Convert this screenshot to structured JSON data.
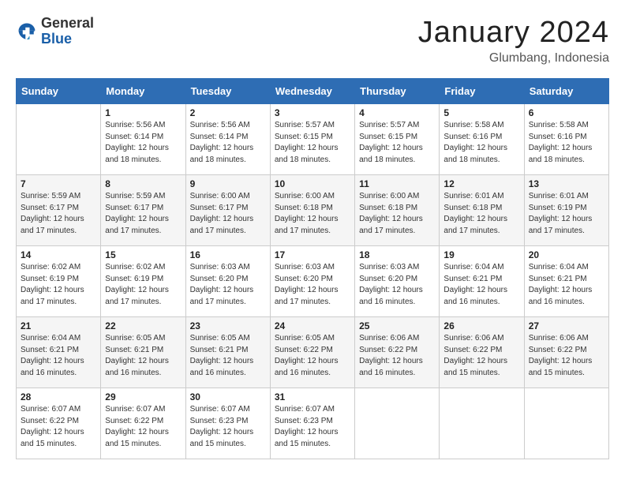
{
  "header": {
    "logo_general": "General",
    "logo_blue": "Blue",
    "month_title": "January 2024",
    "location": "Glumbang, Indonesia"
  },
  "weekdays": [
    "Sunday",
    "Monday",
    "Tuesday",
    "Wednesday",
    "Thursday",
    "Friday",
    "Saturday"
  ],
  "weeks": [
    [
      {
        "day": "",
        "sunrise": "",
        "sunset": "",
        "daylight": ""
      },
      {
        "day": "1",
        "sunrise": "Sunrise: 5:56 AM",
        "sunset": "Sunset: 6:14 PM",
        "daylight": "Daylight: 12 hours and 18 minutes."
      },
      {
        "day": "2",
        "sunrise": "Sunrise: 5:56 AM",
        "sunset": "Sunset: 6:14 PM",
        "daylight": "Daylight: 12 hours and 18 minutes."
      },
      {
        "day": "3",
        "sunrise": "Sunrise: 5:57 AM",
        "sunset": "Sunset: 6:15 PM",
        "daylight": "Daylight: 12 hours and 18 minutes."
      },
      {
        "day": "4",
        "sunrise": "Sunrise: 5:57 AM",
        "sunset": "Sunset: 6:15 PM",
        "daylight": "Daylight: 12 hours and 18 minutes."
      },
      {
        "day": "5",
        "sunrise": "Sunrise: 5:58 AM",
        "sunset": "Sunset: 6:16 PM",
        "daylight": "Daylight: 12 hours and 18 minutes."
      },
      {
        "day": "6",
        "sunrise": "Sunrise: 5:58 AM",
        "sunset": "Sunset: 6:16 PM",
        "daylight": "Daylight: 12 hours and 18 minutes."
      }
    ],
    [
      {
        "day": "7",
        "sunrise": "Sunrise: 5:59 AM",
        "sunset": "Sunset: 6:17 PM",
        "daylight": "Daylight: 12 hours and 17 minutes."
      },
      {
        "day": "8",
        "sunrise": "Sunrise: 5:59 AM",
        "sunset": "Sunset: 6:17 PM",
        "daylight": "Daylight: 12 hours and 17 minutes."
      },
      {
        "day": "9",
        "sunrise": "Sunrise: 6:00 AM",
        "sunset": "Sunset: 6:17 PM",
        "daylight": "Daylight: 12 hours and 17 minutes."
      },
      {
        "day": "10",
        "sunrise": "Sunrise: 6:00 AM",
        "sunset": "Sunset: 6:18 PM",
        "daylight": "Daylight: 12 hours and 17 minutes."
      },
      {
        "day": "11",
        "sunrise": "Sunrise: 6:00 AM",
        "sunset": "Sunset: 6:18 PM",
        "daylight": "Daylight: 12 hours and 17 minutes."
      },
      {
        "day": "12",
        "sunrise": "Sunrise: 6:01 AM",
        "sunset": "Sunset: 6:18 PM",
        "daylight": "Daylight: 12 hours and 17 minutes."
      },
      {
        "day": "13",
        "sunrise": "Sunrise: 6:01 AM",
        "sunset": "Sunset: 6:19 PM",
        "daylight": "Daylight: 12 hours and 17 minutes."
      }
    ],
    [
      {
        "day": "14",
        "sunrise": "Sunrise: 6:02 AM",
        "sunset": "Sunset: 6:19 PM",
        "daylight": "Daylight: 12 hours and 17 minutes."
      },
      {
        "day": "15",
        "sunrise": "Sunrise: 6:02 AM",
        "sunset": "Sunset: 6:19 PM",
        "daylight": "Daylight: 12 hours and 17 minutes."
      },
      {
        "day": "16",
        "sunrise": "Sunrise: 6:03 AM",
        "sunset": "Sunset: 6:20 PM",
        "daylight": "Daylight: 12 hours and 17 minutes."
      },
      {
        "day": "17",
        "sunrise": "Sunrise: 6:03 AM",
        "sunset": "Sunset: 6:20 PM",
        "daylight": "Daylight: 12 hours and 17 minutes."
      },
      {
        "day": "18",
        "sunrise": "Sunrise: 6:03 AM",
        "sunset": "Sunset: 6:20 PM",
        "daylight": "Daylight: 12 hours and 16 minutes."
      },
      {
        "day": "19",
        "sunrise": "Sunrise: 6:04 AM",
        "sunset": "Sunset: 6:21 PM",
        "daylight": "Daylight: 12 hours and 16 minutes."
      },
      {
        "day": "20",
        "sunrise": "Sunrise: 6:04 AM",
        "sunset": "Sunset: 6:21 PM",
        "daylight": "Daylight: 12 hours and 16 minutes."
      }
    ],
    [
      {
        "day": "21",
        "sunrise": "Sunrise: 6:04 AM",
        "sunset": "Sunset: 6:21 PM",
        "daylight": "Daylight: 12 hours and 16 minutes."
      },
      {
        "day": "22",
        "sunrise": "Sunrise: 6:05 AM",
        "sunset": "Sunset: 6:21 PM",
        "daylight": "Daylight: 12 hours and 16 minutes."
      },
      {
        "day": "23",
        "sunrise": "Sunrise: 6:05 AM",
        "sunset": "Sunset: 6:21 PM",
        "daylight": "Daylight: 12 hours and 16 minutes."
      },
      {
        "day": "24",
        "sunrise": "Sunrise: 6:05 AM",
        "sunset": "Sunset: 6:22 PM",
        "daylight": "Daylight: 12 hours and 16 minutes."
      },
      {
        "day": "25",
        "sunrise": "Sunrise: 6:06 AM",
        "sunset": "Sunset: 6:22 PM",
        "daylight": "Daylight: 12 hours and 16 minutes."
      },
      {
        "day": "26",
        "sunrise": "Sunrise: 6:06 AM",
        "sunset": "Sunset: 6:22 PM",
        "daylight": "Daylight: 12 hours and 15 minutes."
      },
      {
        "day": "27",
        "sunrise": "Sunrise: 6:06 AM",
        "sunset": "Sunset: 6:22 PM",
        "daylight": "Daylight: 12 hours and 15 minutes."
      }
    ],
    [
      {
        "day": "28",
        "sunrise": "Sunrise: 6:07 AM",
        "sunset": "Sunset: 6:22 PM",
        "daylight": "Daylight: 12 hours and 15 minutes."
      },
      {
        "day": "29",
        "sunrise": "Sunrise: 6:07 AM",
        "sunset": "Sunset: 6:22 PM",
        "daylight": "Daylight: 12 hours and 15 minutes."
      },
      {
        "day": "30",
        "sunrise": "Sunrise: 6:07 AM",
        "sunset": "Sunset: 6:23 PM",
        "daylight": "Daylight: 12 hours and 15 minutes."
      },
      {
        "day": "31",
        "sunrise": "Sunrise: 6:07 AM",
        "sunset": "Sunset: 6:23 PM",
        "daylight": "Daylight: 12 hours and 15 minutes."
      },
      {
        "day": "",
        "sunrise": "",
        "sunset": "",
        "daylight": ""
      },
      {
        "day": "",
        "sunrise": "",
        "sunset": "",
        "daylight": ""
      },
      {
        "day": "",
        "sunrise": "",
        "sunset": "",
        "daylight": ""
      }
    ]
  ]
}
